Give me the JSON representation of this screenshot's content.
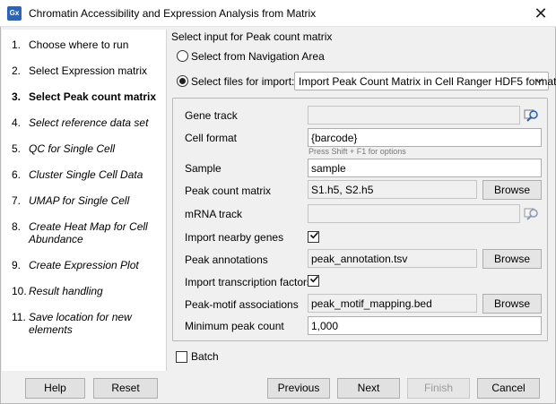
{
  "window": {
    "icon_text": "Gx",
    "title": "Chromatin Accessibility and Expression Analysis from Matrix",
    "close_glyph": "✕"
  },
  "steps": [
    {
      "num": "1.",
      "label": "Choose where to run",
      "style": "normal"
    },
    {
      "num": "2.",
      "label": "Select Expression matrix",
      "style": "normal"
    },
    {
      "num": "3.",
      "label": "Select Peak count matrix",
      "style": "current"
    },
    {
      "num": "4.",
      "label": "Select reference data set",
      "style": "italic"
    },
    {
      "num": "5.",
      "label": "QC for Single Cell",
      "style": "italic"
    },
    {
      "num": "6.",
      "label": "Cluster Single Cell Data",
      "style": "italic"
    },
    {
      "num": "7.",
      "label": "UMAP for Single Cell",
      "style": "italic"
    },
    {
      "num": "8.",
      "label": "Create Heat Map for Cell Abundance",
      "style": "italic"
    },
    {
      "num": "9.",
      "label": "Create Expression Plot",
      "style": "italic"
    },
    {
      "num": "10.",
      "label": "Result handling",
      "style": "italic"
    },
    {
      "num": "11.",
      "label": "Save location for new elements",
      "style": "italic"
    }
  ],
  "input_section": {
    "heading": "Select input for Peak count matrix",
    "option_navigation": "Select from Navigation Area",
    "option_files": "Select files for import:",
    "selected_option": "files",
    "importer_value": "Import Peak Count Matrix in Cell Ranger HDF5 format"
  },
  "fields": {
    "gene_track": {
      "label": "Gene track",
      "value": ""
    },
    "cell_format": {
      "label": "Cell format",
      "value": "{barcode}",
      "hint": "Press Shift + F1 for options"
    },
    "sample": {
      "label": "Sample",
      "value": "sample"
    },
    "peak_count_matrix": {
      "label": "Peak count matrix",
      "value": "S1.h5, S2.h5"
    },
    "mrna_track": {
      "label": "mRNA track",
      "value": ""
    },
    "import_nearby_genes": {
      "label": "Import nearby genes",
      "checked": true
    },
    "peak_annotations": {
      "label": "Peak annotations",
      "value": "peak_annotation.tsv"
    },
    "import_tf": {
      "label": "Import transcription factors",
      "checked": true
    },
    "peak_motif": {
      "label": "Peak-motif associations",
      "value": "peak_motif_mapping.bed"
    },
    "min_peak_count": {
      "label": "Minimum peak count",
      "value": "1,000"
    }
  },
  "browse_label": "Browse",
  "batch": {
    "label": "Batch",
    "checked": false
  },
  "footer": {
    "help": "Help",
    "reset": "Reset",
    "previous": "Previous",
    "next": "Next",
    "finish": "Finish",
    "cancel": "Cancel"
  }
}
